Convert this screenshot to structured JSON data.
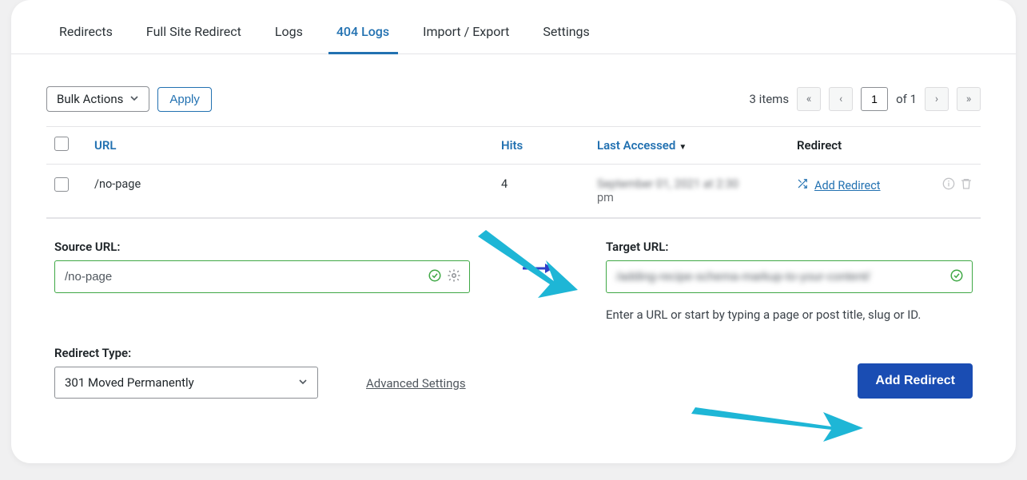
{
  "tabs": [
    "Redirects",
    "Full Site Redirect",
    "Logs",
    "404 Logs",
    "Import / Export",
    "Settings"
  ],
  "active_tab_index": 3,
  "bulk_actions_label": "Bulk Actions",
  "apply_label": "Apply",
  "pagination": {
    "items_text": "3 items",
    "page_value": "1",
    "of_text": "of 1"
  },
  "table": {
    "headers": {
      "url": "URL",
      "hits": "Hits",
      "last_accessed": "Last Accessed",
      "redirect": "Redirect"
    },
    "rows": [
      {
        "url": "/no-page",
        "hits": "4",
        "date_line1": "September 01, 2021 at 2:30",
        "date_line2": "pm",
        "redirect_link": "Add Redirect"
      }
    ]
  },
  "form": {
    "source_label": "Source URL:",
    "source_value": "/no-page",
    "target_label": "Target URL:",
    "target_value": "/adding-recipe-schema-markup-to-your-content/",
    "target_helper": "Enter a URL or start by typing a page or post title, slug or ID."
  },
  "redirect_type": {
    "label": "Redirect Type:",
    "selected": "301 Moved Permanently"
  },
  "advanced_settings_label": "Advanced Settings",
  "add_redirect_button": "Add Redirect"
}
